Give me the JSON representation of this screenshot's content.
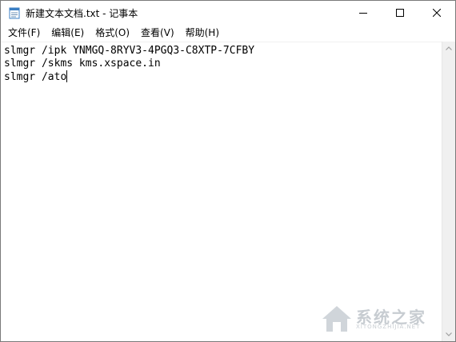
{
  "window": {
    "title": "新建文本文档.txt - 记事本"
  },
  "window_controls": {
    "minimize_icon": "minimize-icon",
    "maximize_icon": "maximize-icon",
    "close_icon": "close-icon"
  },
  "menu": {
    "items": [
      {
        "label": "文件(F)"
      },
      {
        "label": "编辑(E)"
      },
      {
        "label": "格式(O)"
      },
      {
        "label": "查看(V)"
      },
      {
        "label": "帮助(H)"
      }
    ]
  },
  "editor": {
    "lines": [
      "slmgr /ipk YNMGQ-8RYV3-4PGQ3-C8XTP-7CFBY",
      "slmgr /skms kms.xspace.in",
      "slmgr /ato"
    ]
  },
  "watermark": {
    "text": "系统之家",
    "subtext": "XITONGZHIJIA.NET"
  },
  "colors": {
    "window_border": "#7a7a7a",
    "scrollbar_bg": "#f0f0f0",
    "text": "#000000"
  }
}
